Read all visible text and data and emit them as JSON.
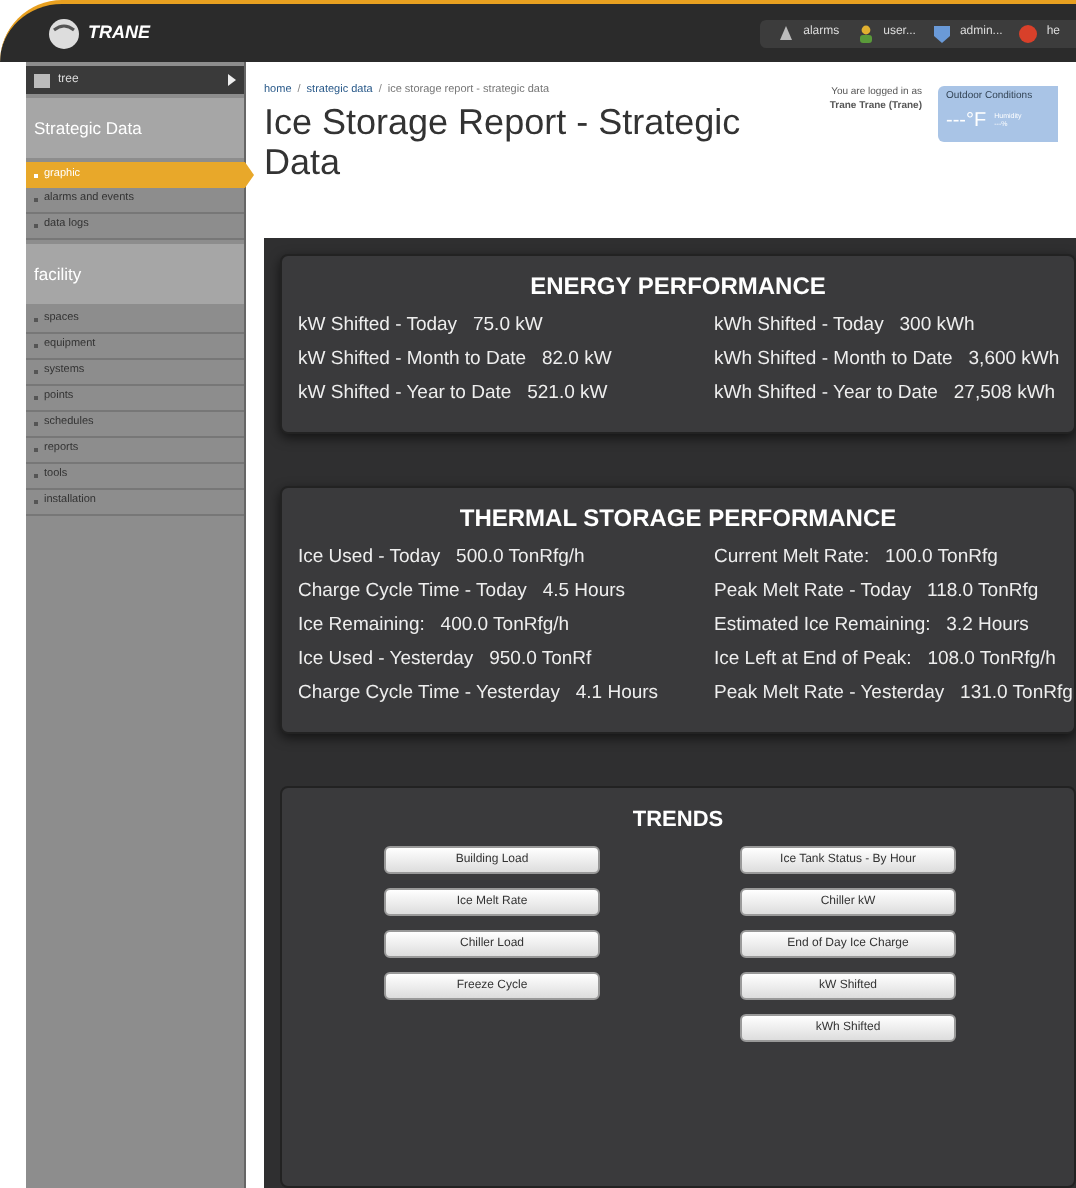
{
  "header": {
    "logo": "TRANE",
    "toolbar": [
      {
        "kind": "bell",
        "label": "alarms"
      },
      {
        "kind": "user",
        "label": "user..."
      },
      {
        "kind": "shield",
        "label": "admin..."
      },
      {
        "kind": "help",
        "label": "he"
      }
    ]
  },
  "sidebar": {
    "tree_label": "tree",
    "sections": [
      {
        "title": "Strategic Data",
        "items": [
          {
            "label": "graphic",
            "selected": true
          },
          {
            "label": "alarms and events",
            "selected": false
          },
          {
            "label": "data logs",
            "selected": false
          }
        ]
      },
      {
        "title": "facility",
        "items": [
          {
            "label": "spaces",
            "selected": false
          },
          {
            "label": "equipment",
            "selected": false
          },
          {
            "label": "systems",
            "selected": false
          },
          {
            "label": "points",
            "selected": false
          },
          {
            "label": "schedules",
            "selected": false
          },
          {
            "label": "reports",
            "selected": false
          },
          {
            "label": "tools",
            "selected": false
          },
          {
            "label": "installation",
            "selected": false
          }
        ]
      }
    ]
  },
  "breadcrumb_separator": "/",
  "breadcrumb": [
    {
      "label": "home",
      "kind": "link"
    },
    {
      "label": "strategic data",
      "kind": "link"
    },
    {
      "label": "ice storage report - strategic data",
      "kind": "current"
    }
  ],
  "page_title": "Ice Storage Report - Strategic Data",
  "login": {
    "line_1": "You are logged in as",
    "line_2": "Trane Trane (Trane)"
  },
  "outdoor": {
    "title": "Outdoor Conditions",
    "temperature": "---°F",
    "detail_1": "Humidity",
    "detail_2": "---%"
  },
  "energy": {
    "title": "ENERGY PERFORMANCE",
    "rows": [
      {
        "left_label": "kW Shifted - Today",
        "left_value": "75.0 kW",
        "right_label": "kWh Shifted - Today",
        "right_value": "300 kWh"
      },
      {
        "left_label": "kW Shifted - Month to Date",
        "left_value": "82.0 kW",
        "right_label": "kWh Shifted - Month to Date",
        "right_value": "3,600 kWh"
      },
      {
        "left_label": "kW Shifted - Year to Date",
        "left_value": "521.0 kW",
        "right_label": "kWh Shifted - Year to Date",
        "right_value": "27,508 kWh"
      }
    ]
  },
  "thermal": {
    "title": "THERMAL STORAGE PERFORMANCE",
    "rows": [
      {
        "left_label": "Ice Used - Today",
        "left_value": "500.0 TonRfg/h",
        "right_label": "Current Melt Rate:",
        "right_value": "100.0 TonRfg"
      },
      {
        "left_label": "Charge Cycle Time - Today",
        "left_value": "4.5  Hours",
        "right_label": "Peak Melt Rate - Today",
        "right_value": "118.0 TonRfg"
      },
      {
        "left_label": "Ice Remaining:",
        "left_value": "400.0 TonRfg/h",
        "right_label": "Estimated Ice Remaining:",
        "right_value": "3.2  Hours"
      },
      {
        "left_label": "Ice Used - Yesterday",
        "left_value": "950.0 TonRf",
        "right_label": "Ice Left at End of Peak:",
        "right_value": "108.0 TonRfg/h"
      },
      {
        "left_label": "Charge Cycle Time - Yesterday",
        "left_value": "4.1 Hours",
        "right_label": "Peak Melt Rate - Yesterday",
        "right_value": "131.0 TonRfg"
      }
    ]
  },
  "trends": {
    "title": "TRENDS",
    "left_buttons": [
      "Building Load",
      "Ice Melt Rate",
      "Chiller Load",
      "Freeze Cycle"
    ],
    "right_buttons": [
      "Ice Tank Status - By Hour",
      "Chiller kW",
      "End of Day Ice Charge",
      "kW Shifted",
      "kWh Shifted"
    ]
  }
}
